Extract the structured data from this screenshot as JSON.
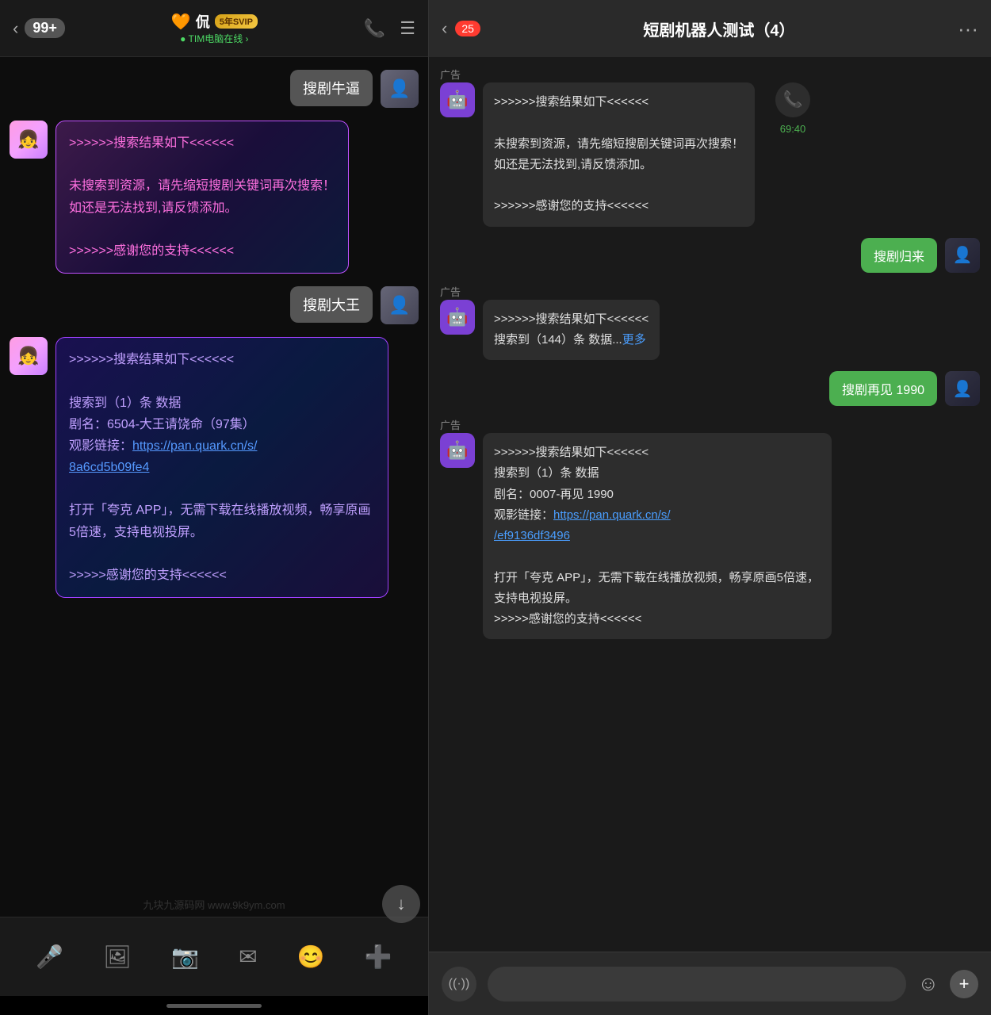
{
  "left": {
    "header": {
      "back": "‹",
      "badge": "99+",
      "username": "侃",
      "vip": "5年SVIP",
      "status": "● TIM电脑在线 ›",
      "phone_icon": "📞",
      "menu_icon": "☰"
    },
    "messages": [
      {
        "id": "msg1",
        "type": "sent",
        "text": "搜剧牛逼"
      },
      {
        "id": "msg2",
        "type": "received",
        "style": "style1",
        "text": ">>>>>>搜索结果如下<<<<<<\n\n未搜索到资源，请先缩短搜剧关键词再次搜索！\n如还是无法找到,请反馈添加。\n\n>>>>>>感谢您的支持<<<<<<"
      },
      {
        "id": "msg3",
        "type": "sent",
        "text": "搜剧大王"
      },
      {
        "id": "msg4",
        "type": "received",
        "style": "style2",
        "text": ">>>>>>搜索结果如下<<<<<<\n\n搜索到（1）条 数据\n剧名：6504-大王请饶命（97集）\n观影链接：",
        "link": "https://pan.quark.cn/s/8a6cd5b09fe4",
        "text2": "\n\n打开「夸克 APP」，无需下载在线播放视频，畅享原画5倍速，支持电视投屏。\n\n>>>>>感谢您的支持<<<<<<"
      }
    ],
    "toolbar": {
      "icons": [
        "🎤",
        "🖼",
        "📷",
        "✉",
        "😊",
        "➕"
      ]
    },
    "watermark": "九块九源码网 www.9k9ym.com"
  },
  "right": {
    "header": {
      "back": "‹",
      "count": "25",
      "title": "短剧机器人测试（4）",
      "more": "···"
    },
    "messages": [
      {
        "id": "r1",
        "type": "received",
        "ad": true,
        "text": ">>>>>>搜索结果如下<<<<<<\n\n未搜索到资源，请先缩短搜剧关键词再次搜索！\n如还是无法找到,请反馈添加。\n\n>>>>>>感谢您的支持<<<<<<",
        "has_call": true,
        "call_time": "69:40"
      },
      {
        "id": "r2",
        "type": "sent",
        "text": "搜剧归来"
      },
      {
        "id": "r3",
        "type": "received",
        "ad": true,
        "text": ">>>>>>搜索结果如下<<<<<<\n搜索到（144）条 数据...",
        "has_more": true
      },
      {
        "id": "r4",
        "type": "sent",
        "text": "搜剧再见 1990"
      },
      {
        "id": "r5",
        "type": "received",
        "ad": true,
        "text": ">>>>>>搜索结果如下<<<<<<\n搜索到（1）条 数据\n剧名：0007-再见 1990\n观影链接：",
        "link": "https://pan.quark.cn/s/ef9136df3496",
        "text2": "\n\n打开「夸克 APP」，无需下载在线播放视频，畅享原画5倍速，支持电视投屏。\n>>>>>感谢您的支持<<<<<<"
      }
    ],
    "bottom": {
      "voice_icon": "((·))",
      "emoji_icon": "☺",
      "plus_icon": "+"
    }
  }
}
